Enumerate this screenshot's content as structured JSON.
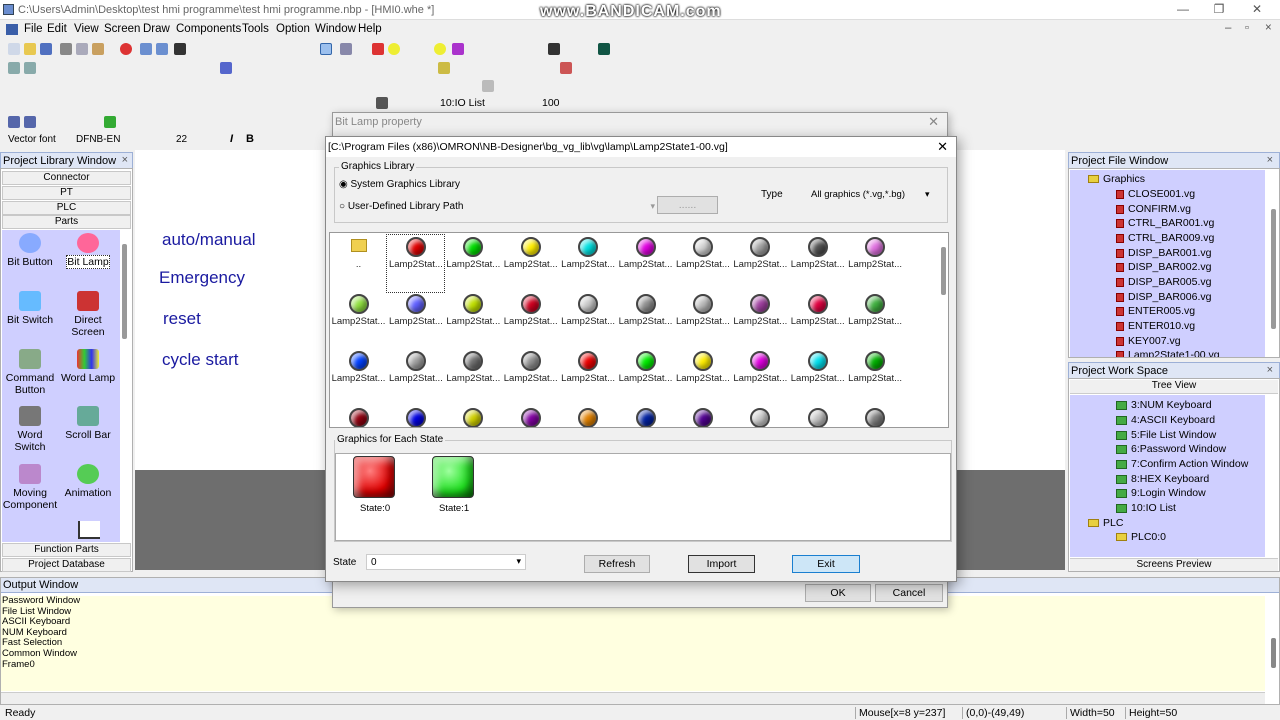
{
  "window": {
    "title": "C:\\Users\\Admin\\Desktop\\test hmi programme\\test hmi programme.nbp - [HMI0.whe *]",
    "watermark": "www.BANDICAM.com"
  },
  "menu": [
    "File",
    "Edit",
    "View",
    "Screen",
    "Draw",
    "Components",
    "Tools",
    "Option",
    "Window",
    "Help"
  ],
  "toolbar": {
    "font": "Vector font",
    "lang": "DFNB-EN",
    "size": "22",
    "io_list": "10:IO List",
    "zoom": "100"
  },
  "library": {
    "title": "Project Library Window",
    "rows": [
      "Connector",
      "PT",
      "PLC",
      "Parts"
    ],
    "parts": [
      {
        "label": "Bit Button"
      },
      {
        "label": "Bit Lamp"
      },
      {
        "label": "Bit Switch"
      },
      {
        "label": "Direct Screen"
      },
      {
        "label": "Command Button"
      },
      {
        "label": "Word Lamp"
      },
      {
        "label": "Word Switch"
      },
      {
        "label": "Scroll Bar"
      },
      {
        "label": "Moving Component"
      },
      {
        "label": "Animation"
      }
    ],
    "footer": [
      "Function Parts",
      "Project Database"
    ]
  },
  "canvas_labels": [
    "auto/manual",
    "Emergency",
    "reset",
    "cycle start"
  ],
  "file_window": {
    "title": "Project File Window",
    "root": "Graphics",
    "files": [
      "CLOSE001.vg",
      "CONFIRM.vg",
      "CTRL_BAR001.vg",
      "CTRL_BAR009.vg",
      "DISP_BAR001.vg",
      "DISP_BAR002.vg",
      "DISP_BAR005.vg",
      "DISP_BAR006.vg",
      "ENTER005.vg",
      "ENTER010.vg",
      "KEY007.vg",
      "Lamp2State1-00.vg"
    ]
  },
  "work_space": {
    "title": "Project Work Space",
    "tab": "Tree View",
    "items": [
      "3:NUM Keyboard",
      "4:ASCII Keyboard",
      "5:File List Window",
      "6:Password Window",
      "7:Confirm Action Window",
      "8:HEX Keyboard",
      "9:Login Window",
      "10:IO List"
    ],
    "plc": "PLC",
    "plc_child": "PLC0:0",
    "footer": "Screens Preview"
  },
  "output": {
    "title": "Output Window",
    "lines": [
      "Password Window",
      "File List Window",
      "ASCII Keyboard",
      "NUM Keyboard",
      "Fast Selection",
      "Common Window",
      "Frame0"
    ]
  },
  "status": {
    "ready": "Ready",
    "mouse": "Mouse[x=8  y=237]",
    "coords": "(0,0)-(49,49)",
    "width": "Width=50",
    "height": "Height=50"
  },
  "bitlamp_dialog": {
    "title": "Bit Lamp property",
    "ok": "OK",
    "cancel": "Cancel"
  },
  "gfx_dialog": {
    "title": "[C:\\Program Files (x86)\\OMRON\\NB-Designer\\bg_vg_lib\\vg\\lamp\\Lamp2State1-00.vg]",
    "group": "Graphics Library",
    "opt1": "System Graphics Library",
    "opt2": "User-Defined Library Path",
    "browse": "......",
    "type_label": "Type",
    "type_value": "All graphics (*.vg,*.bg)",
    "caption": "Lamp2Stat...",
    "folder_caption": "..",
    "state_group": "Graphics for Each State",
    "state0": "State:0",
    "state1": "State:1",
    "state_label": "State",
    "state_value": "0",
    "refresh": "Refresh",
    "import": "Import",
    "exit": "Exit"
  },
  "colors": {
    "r1": [
      "#e00000",
      "#00dd00",
      "#ffee00",
      "#00e0e0",
      "#e000e0",
      "#d0d0d0",
      "#a0a0a0",
      "#505050",
      "#e070e0"
    ],
    "r2": [
      "#90e040",
      "#6060ff",
      "#c0e000",
      "#d00020",
      "#c8c8c8",
      "#909090",
      "#b8b8b8",
      "#a040a0",
      "#e00040",
      "#40b040"
    ],
    "r3": [
      "#0040ff",
      "#a0a0a0",
      "#707070",
      "#909090",
      "#ee0000",
      "#00ee00",
      "#ffee00",
      "#e000e0",
      "#00e0ee",
      "#00b000"
    ],
    "r4": [
      "#900010",
      "#0000e0",
      "#d0d000",
      "#8000a0",
      "#e08000",
      "#0020a0",
      "#500090",
      "#c8c8c8",
      "#c0c0c0",
      "#808080"
    ]
  }
}
